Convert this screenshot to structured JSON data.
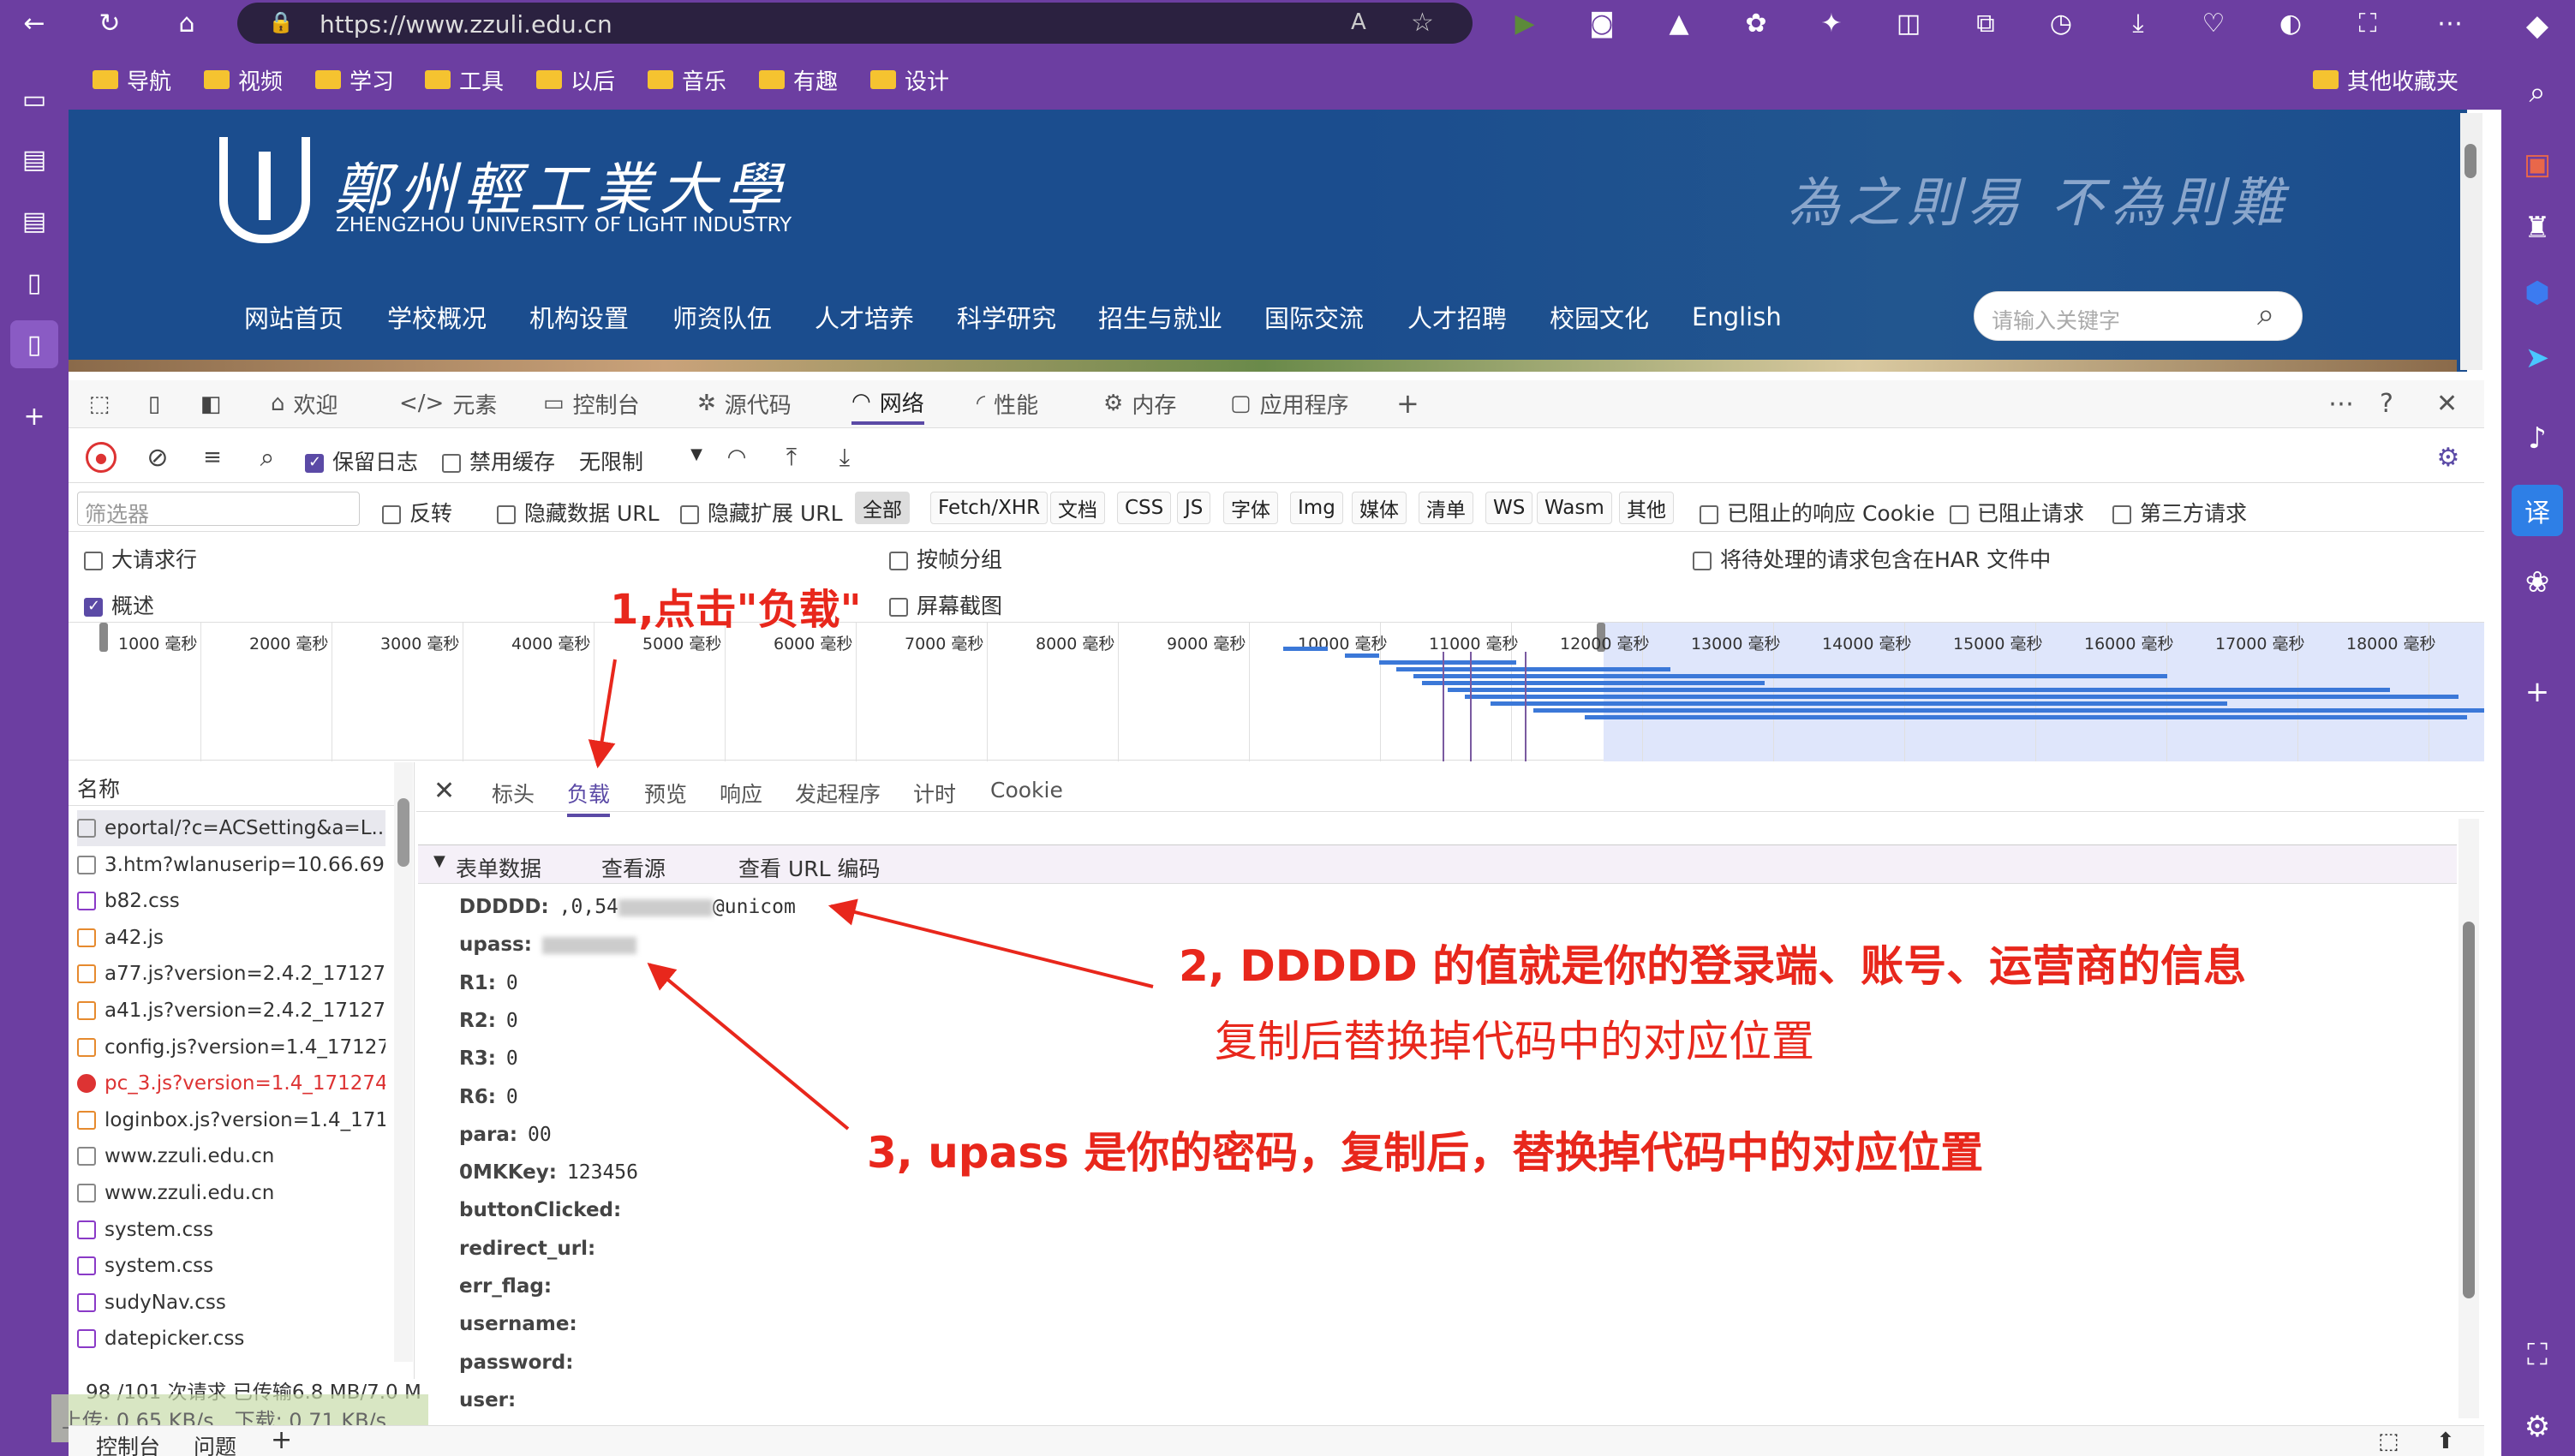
{
  "browser": {
    "url": "https://www.zzuli.edu.cn",
    "bookmarks": [
      "导航",
      "视频",
      "学习",
      "工具",
      "以后",
      "音乐",
      "有趣",
      "设计"
    ],
    "other_bookmarks": "其他收藏夹"
  },
  "site": {
    "name_cn": "鄭州輕工業大學",
    "name_en": "ZHENGZHOU UNIVERSITY OF LIGHT INDUSTRY",
    "motto": "為之則易 不為則難",
    "nav": [
      "网站首页",
      "学校概况",
      "机构设置",
      "师资队伍",
      "人才培养",
      "科学研究",
      "招生与就业",
      "国际交流",
      "人才招聘",
      "校园文化",
      "English"
    ],
    "search_placeholder": "请输入关键字"
  },
  "devtools": {
    "tabs": [
      "欢迎",
      "元素",
      "控制台",
      "源代码",
      "网络",
      "性能",
      "内存",
      "应用程序"
    ],
    "active_tab": "网络",
    "toolbar": {
      "preserve_log": "保留日志",
      "disable_cache": "禁用缓存",
      "throttle": "无限制"
    },
    "filter_placeholder": "筛选器",
    "filter_opts": [
      "反转",
      "隐藏数据 URL",
      "隐藏扩展 URL"
    ],
    "type_chips": [
      "全部",
      "Fetch/XHR",
      "文档",
      "CSS",
      "JS",
      "字体",
      "Img",
      "媒体",
      "清单",
      "WS",
      "Wasm",
      "其他"
    ],
    "blocked_opts": [
      "已阻止的响应 Cookie",
      "已阻止请求",
      "第三方请求"
    ],
    "row2": {
      "big_rows": "大请求行",
      "group_by_frame": "按帧分组",
      "har_option": "将待处理的请求包含在HAR 文件中"
    },
    "row3": {
      "overview": "概述",
      "screenshots": "屏幕截图"
    },
    "timeline_ticks": [
      "1000 毫秒",
      "2000 毫秒",
      "3000 毫秒",
      "4000 毫秒",
      "5000 毫秒",
      "6000 毫秒",
      "7000 毫秒",
      "8000 毫秒",
      "9000 毫秒",
      "10000 毫秒",
      "11000 毫秒",
      "12000 毫秒",
      "13000 毫秒",
      "14000 毫秒",
      "15000 毫秒",
      "16000 毫秒",
      "17000 毫秒",
      "18000 毫秒"
    ],
    "name_header": "名称",
    "files": [
      {
        "name": "eportal/?c=ACSetting&a=L...",
        "type": "doc"
      },
      {
        "name": "3.htm?wlanuserip=10.66.69....",
        "type": "doc"
      },
      {
        "name": "b82.css",
        "type": "css"
      },
      {
        "name": "a42.js",
        "type": "js"
      },
      {
        "name": "a77.js?version=2.4.2_17127...",
        "type": "js"
      },
      {
        "name": "a41.js?version=2.4.2_17127...",
        "type": "js"
      },
      {
        "name": "config.js?version=1.4_17127...",
        "type": "js"
      },
      {
        "name": "pc_3.js?version=1.4_171274...",
        "type": "err"
      },
      {
        "name": "loginbox.js?version=1.4_171...",
        "type": "js"
      },
      {
        "name": "www.zzuli.edu.cn",
        "type": "doc"
      },
      {
        "name": "www.zzuli.edu.cn",
        "type": "doc"
      },
      {
        "name": "system.css",
        "type": "css"
      },
      {
        "name": "system.css",
        "type": "css"
      },
      {
        "name": "sudyNav.css",
        "type": "css"
      },
      {
        "name": "datepicker.css",
        "type": "css"
      }
    ],
    "status": "98 /101 次请求  已传输6.8 MB/7.0 M",
    "speed_up": "上传: 0.65 KB/s",
    "speed_down": "下载: 0.71 KB/s",
    "drawer_tabs": [
      "控制台",
      "问题"
    ],
    "detail_tabs": [
      "标头",
      "负载",
      "预览",
      "响应",
      "发起程序",
      "计时",
      "Cookie"
    ],
    "active_detail_tab": "负载",
    "form_section": "表单数据",
    "view_source": "查看源",
    "view_url_encoded": "查看 URL 编码",
    "form_fields": [
      {
        "k": "DDDDD:",
        "v": ",0,54"
      },
      {
        "k": "upass:",
        "v": ""
      },
      {
        "k": "R1:",
        "v": "0"
      },
      {
        "k": "R2:",
        "v": "0"
      },
      {
        "k": "R3:",
        "v": "0"
      },
      {
        "k": "R6:",
        "v": "0"
      },
      {
        "k": "para:",
        "v": "00"
      },
      {
        "k": "0MKKey:",
        "v": "123456"
      },
      {
        "k": "buttonClicked:",
        "v": ""
      },
      {
        "k": "redirect_url:",
        "v": ""
      },
      {
        "k": "err_flag:",
        "v": ""
      },
      {
        "k": "username:",
        "v": ""
      },
      {
        "k": "password:",
        "v": ""
      },
      {
        "k": "user:",
        "v": ""
      }
    ],
    "ddddd_suffix": "@unicom"
  },
  "annotations": {
    "a1": "1,点击\"负载\"",
    "a2_line1": "2, DDDDD 的值就是你的登录端、账号、运营商的信息",
    "a2_line2": "复制后替换掉代码中的对应位置",
    "a3": "3, upass 是你的密码，复制后，替换掉代码中的对应位置"
  },
  "colors": {
    "chrome": "#6c3ea1",
    "site": "#1b4d8e",
    "accent": "#5b4aa6",
    "annotation": "#e8271c"
  }
}
